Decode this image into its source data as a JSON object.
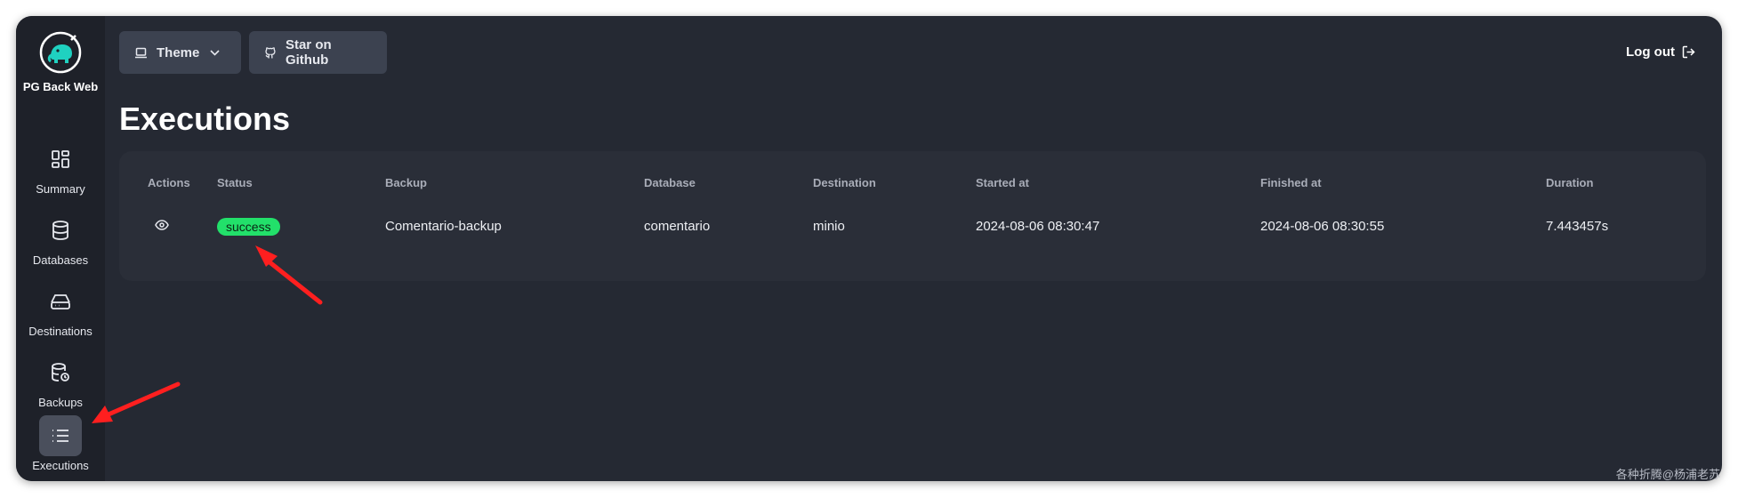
{
  "app": {
    "name": "PG Back Web"
  },
  "sidebar": {
    "items": [
      {
        "label": "Summary",
        "icon": "layout-dashboard-icon"
      },
      {
        "label": "Databases",
        "icon": "database-icon"
      },
      {
        "label": "Destinations",
        "icon": "hard-drive-icon"
      },
      {
        "label": "Backups",
        "icon": "database-backup-icon"
      },
      {
        "label": "Executions",
        "icon": "list-icon",
        "active": true
      }
    ]
  },
  "topbar": {
    "theme_label": "Theme",
    "github_label": "Star on Github",
    "logout_label": "Log out"
  },
  "page": {
    "title": "Executions"
  },
  "table": {
    "headers": [
      "Actions",
      "Status",
      "Backup",
      "Database",
      "Destination",
      "Started at",
      "Finished at",
      "Duration"
    ],
    "rows": [
      {
        "status": "success",
        "backup": "Comentario-backup",
        "database": "comentario",
        "destination": "minio",
        "started_at": "2024-08-06 08:30:47",
        "finished_at": "2024-08-06 08:30:55",
        "duration": "7.443457s"
      }
    ]
  },
  "colors": {
    "background": "#252933",
    "sidebar": "#1e2129",
    "card": "#2a2e38",
    "success": "#22e06a",
    "accent": "#1fd1c0",
    "annotation_arrow": "#ff1f1f"
  },
  "watermark": "各种折腾@杨浦老苏"
}
